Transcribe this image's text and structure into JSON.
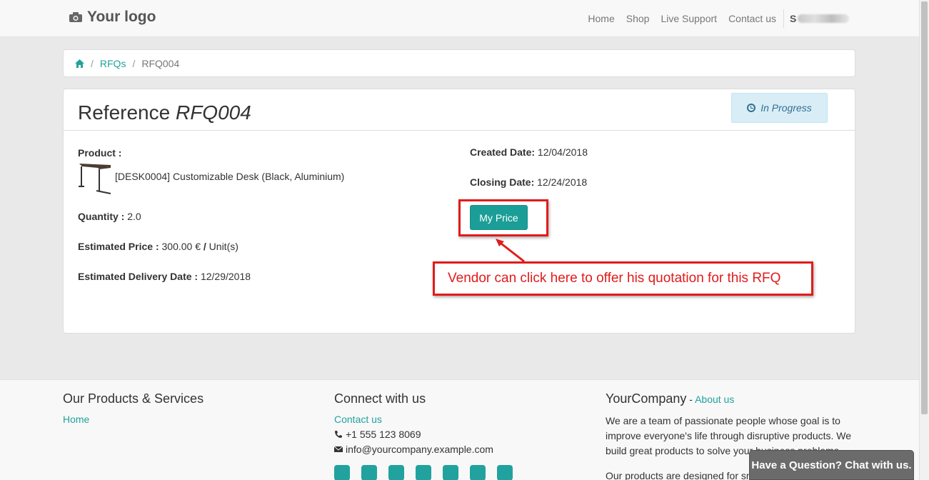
{
  "navbar": {
    "logo_text": "Your logo",
    "items": [
      "Home",
      "Shop",
      "Live Support",
      "Contact us"
    ],
    "user_initial": "S"
  },
  "breadcrumb": {
    "items": [
      "RFQs",
      "RFQ004"
    ]
  },
  "panel": {
    "title_prefix": "Reference",
    "title_ref": "RFQ004",
    "status": "In Progress",
    "product_label": "Product :",
    "product_name": "[DESK0004] Customizable Desk (Black, Aluminium)",
    "quantity_label": "Quantity :",
    "quantity_value": "2.0",
    "est_price_label": "Estimated Price :",
    "est_price_value": "300.00 €",
    "est_price_sep": "/",
    "est_price_unit": "Unit(s)",
    "est_delivery_label": "Estimated Delivery Date :",
    "est_delivery_value": "12/29/2018",
    "created_label": "Created Date:",
    "created_value": "12/04/2018",
    "closing_label": "Closing Date:",
    "closing_value": "12/24/2018",
    "my_price_button": "My Price"
  },
  "annotation": {
    "text": "Vendor can click here to offer his quotation for this RFQ"
  },
  "footer": {
    "col1_title": "Our Products & Services",
    "col1_link": "Home",
    "col2_title": "Connect with us",
    "col2_link": "Contact us",
    "phone": "+1 555 123 8069",
    "email": "info@yourcompany.example.com",
    "col3_title": "YourCompany",
    "col3_sep": " - ",
    "col3_link": "About us",
    "col3_text1": "We are a team of passionate people whose goal is to improve everyone's life through disruptive products. We build great products to solve your business problems.",
    "col3_text2": "Our products are designed for small to medium size"
  },
  "chat": {
    "label": "Have a Question? Chat with us."
  },
  "colors": {
    "accent": "#21a29e",
    "button": "#1b9e97",
    "annotation": "#e21b1b",
    "status_bg": "#d9edf7"
  }
}
